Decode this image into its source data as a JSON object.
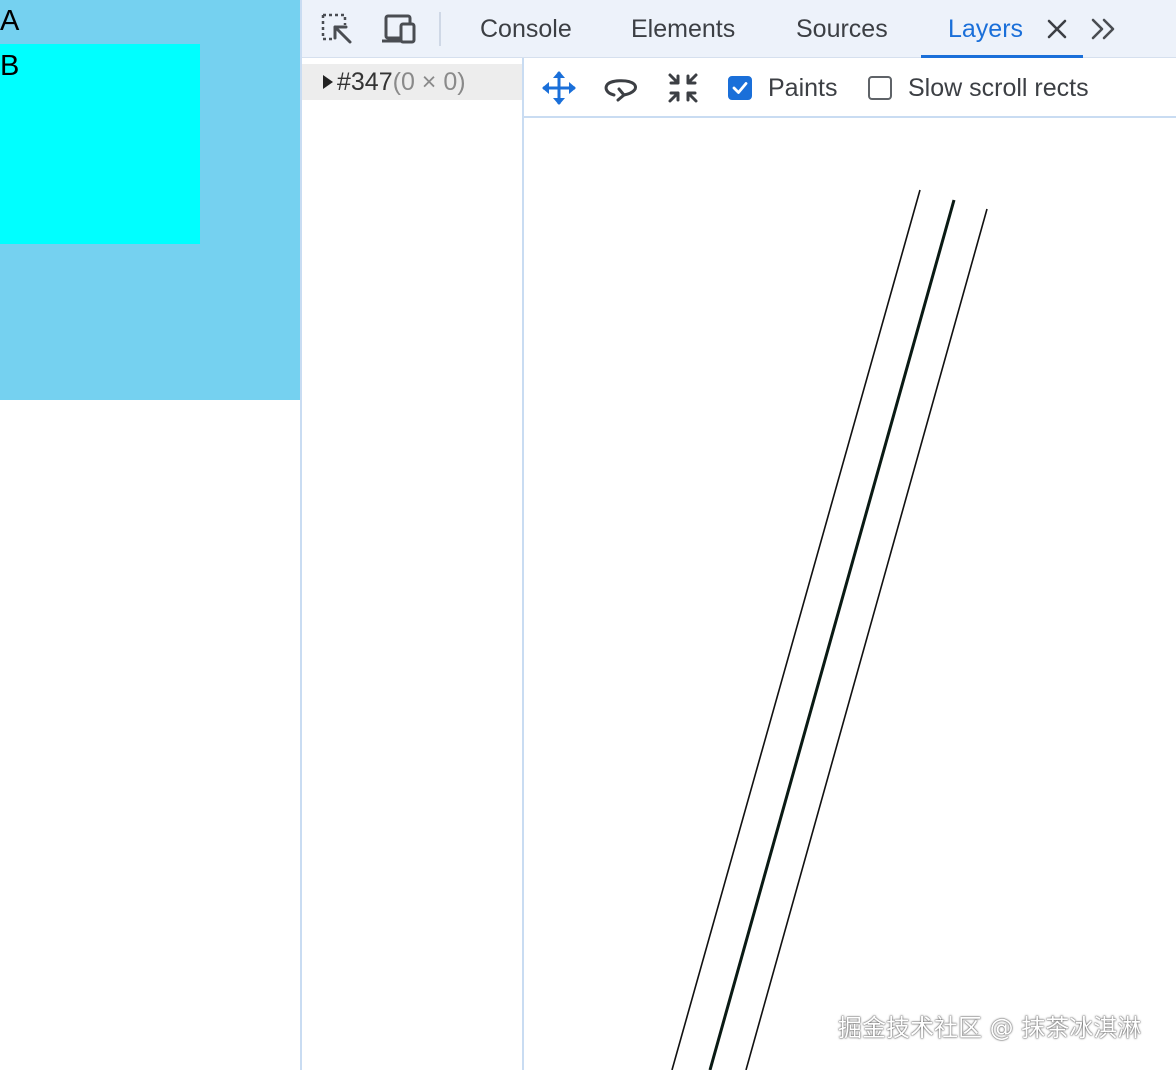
{
  "page": {
    "box_a": {
      "label": "A",
      "color": "#75d1f0"
    },
    "box_b": {
      "label": "B",
      "color": "#00ffff"
    }
  },
  "devtools": {
    "toolbar_icons": [
      "inspect-element-icon",
      "device-toolbar-icon"
    ],
    "tabs": [
      {
        "label": "Console",
        "active": false
      },
      {
        "label": "Elements",
        "active": false
      },
      {
        "label": "Sources",
        "active": false
      },
      {
        "label": "Layers",
        "active": true
      }
    ],
    "close_tab_icon": "close-icon",
    "more_tabs_icon": "chevron-double-right-icon",
    "accent_color": "#1a6fd9",
    "layer_tree": {
      "items": [
        {
          "id": "#347",
          "size": "(0 × 0)",
          "expanded": false
        }
      ]
    },
    "viewer_toolbar": {
      "tools": [
        "pan-mode-icon",
        "rotate-mode-icon",
        "reset-transform-icon"
      ],
      "paints": {
        "label": "Paints",
        "checked": true
      },
      "slow_scroll_rects": {
        "label": "Slow scroll rects",
        "checked": false
      }
    }
  },
  "watermark": "掘金技术社区 @ 抹茶冰淇淋"
}
